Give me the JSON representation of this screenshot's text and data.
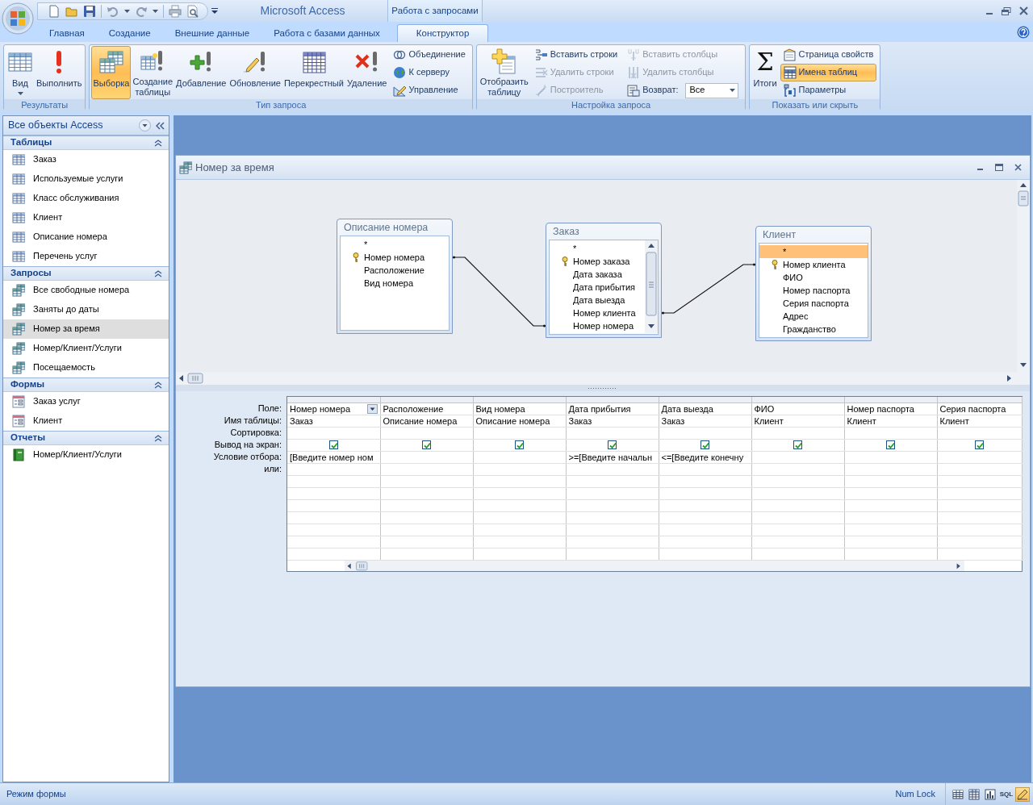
{
  "app": {
    "title": "Microsoft Access",
    "context_tab": "Работа с запросами"
  },
  "ribbon_tabs": [
    {
      "label": "Главная",
      "selected": false
    },
    {
      "label": "Создание",
      "selected": false
    },
    {
      "label": "Внешние данные",
      "selected": false
    },
    {
      "label": "Работа с базами данных",
      "selected": false
    },
    {
      "label": "Конструктор",
      "selected": true
    }
  ],
  "ribbon_groups": [
    {
      "title": "Результаты",
      "items": [
        {
          "kind": "large",
          "label": "Вид",
          "menu": true,
          "selected": false,
          "disabled": false
        },
        {
          "kind": "large",
          "label": "Выполнить",
          "menu": false,
          "selected": false,
          "disabled": false
        }
      ]
    },
    {
      "title": "Тип запроса",
      "items": [
        {
          "kind": "large",
          "label": "Выборка",
          "menu": false,
          "selected": true,
          "disabled": false
        },
        {
          "kind": "large",
          "label": "Создание\nтаблицы",
          "menu": false,
          "selected": false,
          "disabled": false
        },
        {
          "kind": "large",
          "label": "Добавление",
          "menu": false,
          "selected": false,
          "disabled": false
        },
        {
          "kind": "large",
          "label": "Обновление",
          "menu": false,
          "selected": false,
          "disabled": false
        },
        {
          "kind": "large",
          "label": "Перекрестный",
          "menu": false,
          "selected": false,
          "disabled": false
        },
        {
          "kind": "large",
          "label": "Удаление",
          "menu": false,
          "selected": false,
          "disabled": false
        },
        {
          "kind": "small",
          "label": "Объединение",
          "selected": false,
          "disabled": false
        },
        {
          "kind": "small",
          "label": "К серверу",
          "selected": false,
          "disabled": false
        },
        {
          "kind": "small",
          "label": "Управление",
          "selected": false,
          "disabled": false
        }
      ]
    },
    {
      "title": "Настройка запроса",
      "items": [
        {
          "kind": "large",
          "label": "Отобразить\nтаблицу",
          "menu": false,
          "selected": false,
          "disabled": false
        },
        {
          "kind": "small",
          "label": "Вставить строки",
          "selected": false,
          "disabled": false
        },
        {
          "kind": "small",
          "label": "Удалить строки",
          "selected": false,
          "disabled": true
        },
        {
          "kind": "small",
          "label": "Построитель",
          "selected": false,
          "disabled": true
        },
        {
          "kind": "small",
          "label": "Вставить столбцы",
          "selected": false,
          "disabled": true
        },
        {
          "kind": "small",
          "label": "Удалить столбцы",
          "selected": false,
          "disabled": true
        },
        {
          "kind": "combo",
          "label": "Возврат:",
          "value": "Все",
          "selected": false,
          "disabled": false
        }
      ]
    },
    {
      "title": "Показать или скрыть",
      "items": [
        {
          "kind": "large",
          "label": "Итоги",
          "glyph": "Σ",
          "menu": false,
          "selected": false,
          "disabled": false
        },
        {
          "kind": "small",
          "label": "Страница свойств",
          "selected": false,
          "disabled": false
        },
        {
          "kind": "small",
          "label": "Имена таблиц",
          "selected": true,
          "disabled": false
        },
        {
          "kind": "small",
          "label": "Параметры",
          "selected": false,
          "disabled": false
        }
      ]
    }
  ],
  "navigation": {
    "title": "Все объекты Access",
    "sections": [
      {
        "title": "Таблицы",
        "kind": "tables",
        "items": [
          {
            "label": "Заказ",
            "selected": false
          },
          {
            "label": "Используемые услуги",
            "selected": false
          },
          {
            "label": "Класс обслуживания",
            "selected": false
          },
          {
            "label": "Клиент",
            "selected": false
          },
          {
            "label": "Описание номера",
            "selected": false
          },
          {
            "label": "Перечень услуг",
            "selected": false
          }
        ]
      },
      {
        "title": "Запросы",
        "kind": "queries",
        "items": [
          {
            "label": "Все свободные номера",
            "selected": false
          },
          {
            "label": "Заняты до даты",
            "selected": false
          },
          {
            "label": "Номер за время",
            "selected": true
          },
          {
            "label": "Номер/Клиент/Услуги",
            "selected": false
          },
          {
            "label": "Посещаемость",
            "selected": false
          }
        ]
      },
      {
        "title": "Формы",
        "kind": "forms",
        "items": [
          {
            "label": "Заказ услуг",
            "selected": false
          },
          {
            "label": "Клиент",
            "selected": false
          }
        ]
      },
      {
        "title": "Отчеты",
        "kind": "reports",
        "items": [
          {
            "label": "Номер/Клиент/Услуги",
            "selected": false
          }
        ]
      }
    ]
  },
  "query_window": {
    "title": "Номер за время",
    "tables": [
      {
        "title": "Описание номера",
        "scrollbar": false,
        "fields": [
          {
            "label": "*",
            "key": false,
            "selected": false
          },
          {
            "label": "Номер номера",
            "key": true,
            "selected": false
          },
          {
            "label": "Расположение",
            "key": false,
            "selected": false
          },
          {
            "label": "Вид номера",
            "key": false,
            "selected": false
          }
        ]
      },
      {
        "title": "Заказ",
        "scrollbar": true,
        "fields": [
          {
            "label": "*",
            "key": false,
            "selected": false
          },
          {
            "label": "Номер заказа",
            "key": true,
            "selected": false
          },
          {
            "label": "Дата заказа",
            "key": false,
            "selected": false
          },
          {
            "label": "Дата прибытия",
            "key": false,
            "selected": false
          },
          {
            "label": "Дата выезда",
            "key": false,
            "selected": false
          },
          {
            "label": "Номер клиента",
            "key": false,
            "selected": false
          },
          {
            "label": "Номер номера",
            "key": false,
            "selected": false
          }
        ]
      },
      {
        "title": "Клиент",
        "scrollbar": false,
        "fields": [
          {
            "label": "*",
            "key": false,
            "selected": true
          },
          {
            "label": "Номер клиента",
            "key": true,
            "selected": false
          },
          {
            "label": "ФИО",
            "key": false,
            "selected": false
          },
          {
            "label": "Номер паспорта",
            "key": false,
            "selected": false
          },
          {
            "label": "Серия паспорта",
            "key": false,
            "selected": false
          },
          {
            "label": "Адрес",
            "key": false,
            "selected": false
          },
          {
            "label": "Гражданство",
            "key": false,
            "selected": false
          }
        ]
      }
    ],
    "grid": {
      "row_labels": [
        "Поле:",
        "Имя таблицы:",
        "Сортировка:",
        "Вывод на экран:",
        "Условие отбора:",
        "или:"
      ],
      "columns": [
        {
          "field": "Номер номера",
          "table": "Заказ",
          "show": true,
          "active": true,
          "criteria": "[Введите номер ном"
        },
        {
          "field": "Расположение",
          "table": "Описание номера",
          "show": true,
          "active": false
        },
        {
          "field": "Вид номера",
          "table": "Описание номера",
          "show": true,
          "active": false
        },
        {
          "field": "Дата прибытия",
          "table": "Заказ",
          "show": true,
          "active": false,
          "criteria": ">=[Введите начальн"
        },
        {
          "field": "Дата выезда",
          "table": "Заказ",
          "show": true,
          "active": false,
          "criteria": "<=[Введите конечну"
        },
        {
          "field": "ФИО",
          "table": "Клиент",
          "show": true,
          "active": false
        },
        {
          "field": "Номер паспорта",
          "table": "Клиент",
          "show": true,
          "active": false
        },
        {
          "field": "Серия паспорта",
          "table": "Клиент",
          "show": true,
          "active": false
        }
      ]
    }
  },
  "status_bar": {
    "mode": "Режим формы",
    "indicators": [
      "Num Lock"
    ],
    "views": [
      {
        "selected": false
      },
      {
        "selected": false
      },
      {
        "selected": false
      },
      {
        "label": "SQL",
        "selected": false
      },
      {
        "selected": true
      }
    ]
  }
}
